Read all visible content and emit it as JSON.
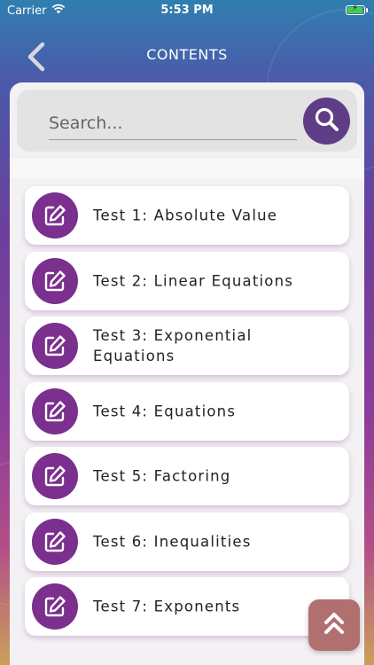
{
  "status_bar": {
    "carrier": "Carrier",
    "time": "5:53 PM",
    "battery_level": 0.85,
    "battery_color": "#46d04a"
  },
  "nav": {
    "title": "CONTENTS",
    "back_icon": "chevron-left-icon"
  },
  "search": {
    "placeholder": "Search...",
    "value": "",
    "icon": "search-icon",
    "button_color": "#5f3d86"
  },
  "items": [
    {
      "label": "Test 1: Absolute Value",
      "icon": "edit-icon"
    },
    {
      "label": "Test 2: Linear Equations",
      "icon": "edit-icon"
    },
    {
      "label": "Test 3: Exponential Equations",
      "icon": "edit-icon"
    },
    {
      "label": "Test 4: Equations",
      "icon": "edit-icon"
    },
    {
      "label": "Test 5: Factoring",
      "icon": "edit-icon"
    },
    {
      "label": "Test 6: Inequalities",
      "icon": "edit-icon"
    },
    {
      "label": "Test 7: Exponents",
      "icon": "edit-icon"
    }
  ],
  "colors": {
    "item_icon_bg": "#7b2f8e",
    "scroll_top_bg": "#b26f6f"
  },
  "scroll_top": {
    "icon": "double-chevron-up-icon"
  }
}
